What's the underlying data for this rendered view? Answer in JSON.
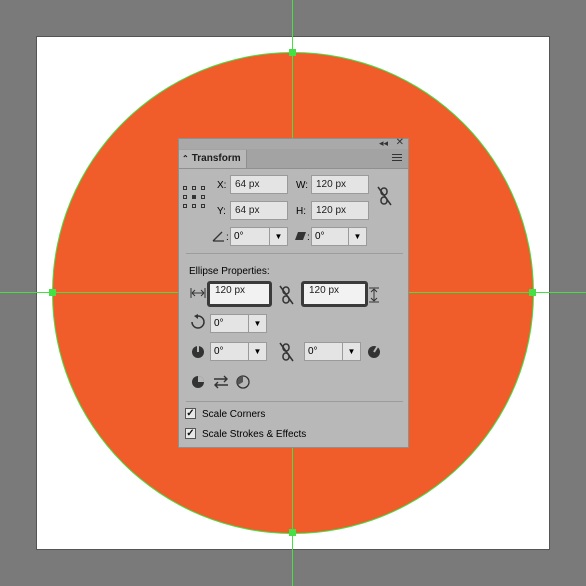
{
  "panel": {
    "title": "Transform",
    "x": "64 px",
    "y": "64 px",
    "w": "120 px",
    "h": "120 px",
    "x_label": "X:",
    "y_label": "Y:",
    "w_label": "W:",
    "h_label": "H:",
    "angle_value": "0°",
    "shear_value": "0°",
    "ellipse_section_label": "Ellipse Properties:",
    "ellipse_width": "120 px",
    "ellipse_height": "120 px",
    "ellipse_rotation": "0°",
    "pie_start": "0°",
    "pie_end": "0°",
    "scale_corners_label": "Scale Corners",
    "scale_strokes_label": "Scale Strokes & Effects",
    "scale_corners_checked": true,
    "scale_strokes_checked": true
  },
  "colors": {
    "canvas_bg": "#7a7a7a",
    "artboard": "#ffffff",
    "ellipse_fill": "#f15c2b",
    "guides": "#46e046",
    "panel_bg": "#b8b8b8"
  },
  "icons": [
    "collapse-icon",
    "close-icon",
    "panel-menu-icon",
    "reference-point-icon",
    "constrain-link-icon",
    "angle-icon",
    "shear-icon",
    "width-arrows-icon",
    "height-arrows-icon",
    "rotate-icon",
    "pie-start-icon",
    "pie-end-icon",
    "pie-link-icon",
    "invert-pie-icon",
    "swap-icon",
    "reset-pie-icon"
  ]
}
